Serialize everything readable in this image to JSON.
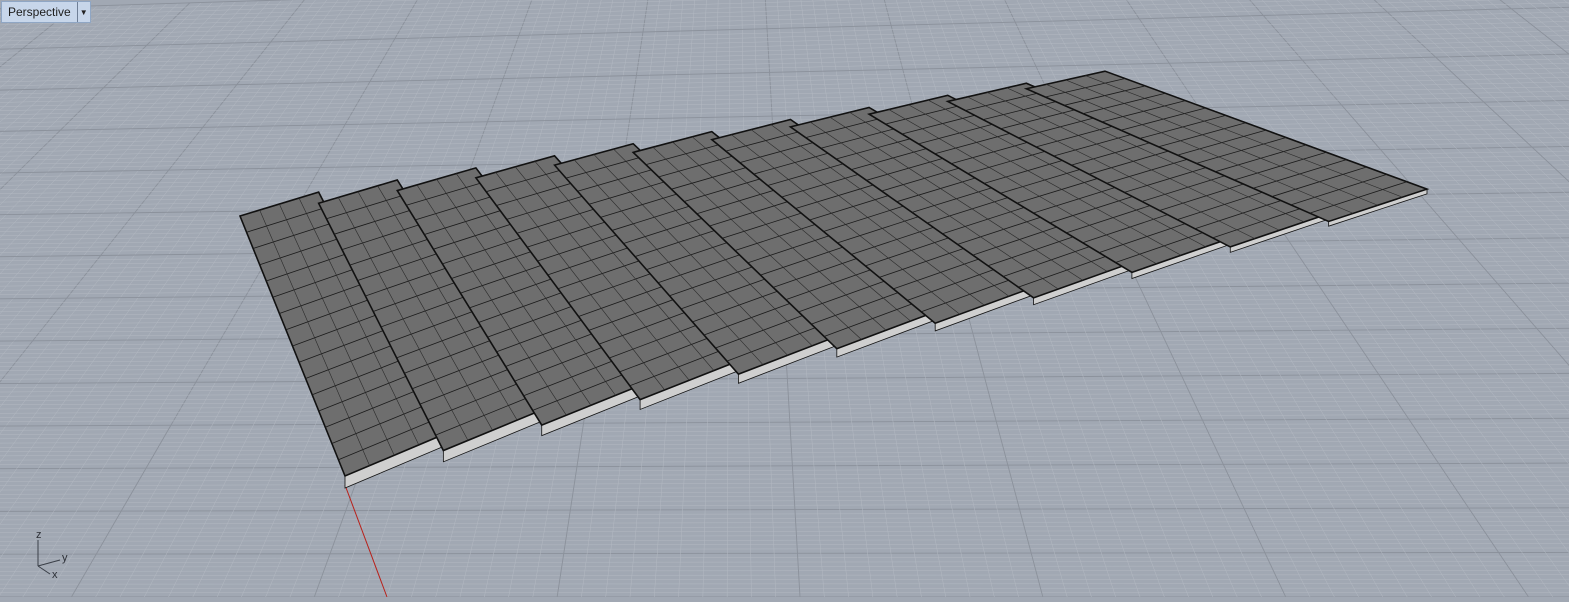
{
  "viewport": {
    "title": "Perspective",
    "dropdown_icon": "chevron-down-icon"
  },
  "axis_widget": {
    "z_label": "z",
    "y_label": "y",
    "x_label": "x"
  },
  "colors": {
    "background": "#a1a8b3",
    "grid_minor": "#b3b9c2",
    "grid_major": "#8b919b",
    "axis_x": "#b8201a",
    "panel_top": "#6e6e6e",
    "panel_side": "#cfcfcf",
    "panel_edge": "#111111"
  }
}
